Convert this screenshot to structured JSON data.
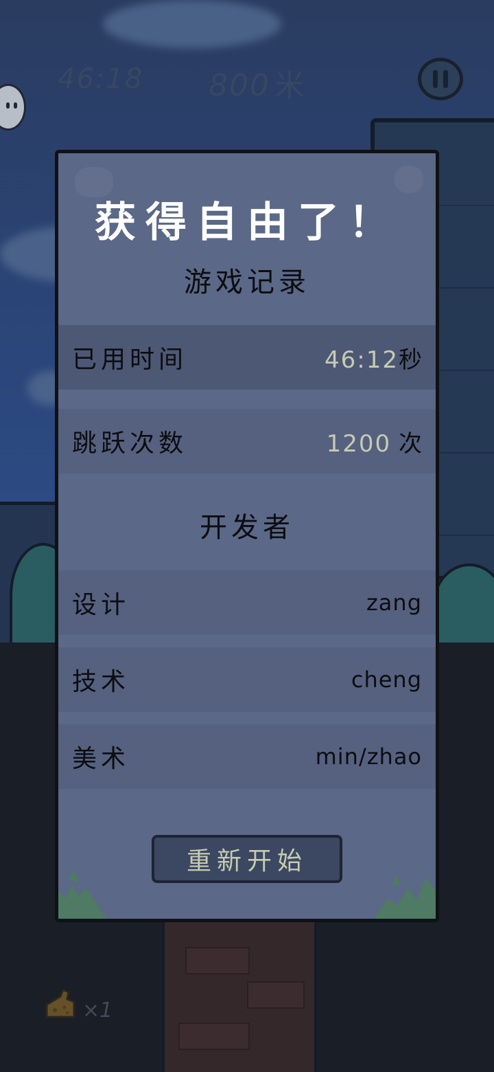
{
  "hud": {
    "time": "46:18",
    "distance": "800",
    "distance_unit": "米",
    "lives_count": "×1"
  },
  "icons": {
    "pause": "pause-icon",
    "character": "character-icon",
    "lives": "cheese-icon"
  },
  "dialog": {
    "title": "获得自由了！",
    "stats_heading": "游戏记录",
    "stats": [
      {
        "label": "已用时间",
        "value": "46:12",
        "unit": "秒"
      },
      {
        "label": "跳跃次数",
        "value": "1200",
        "unit": "次"
      }
    ],
    "credits_heading": "开发者",
    "credits": [
      {
        "role": "设计",
        "name": "zang"
      },
      {
        "role": "技术",
        "name": "cheng"
      },
      {
        "role": "美术",
        "name": "min/zhao"
      }
    ],
    "restart_label": "重新开始"
  },
  "colors": {
    "dialog_bg": "#5b6887",
    "accent_value": "#c6cbb3",
    "sky": "#2c4a86",
    "ground": "#15171c"
  }
}
